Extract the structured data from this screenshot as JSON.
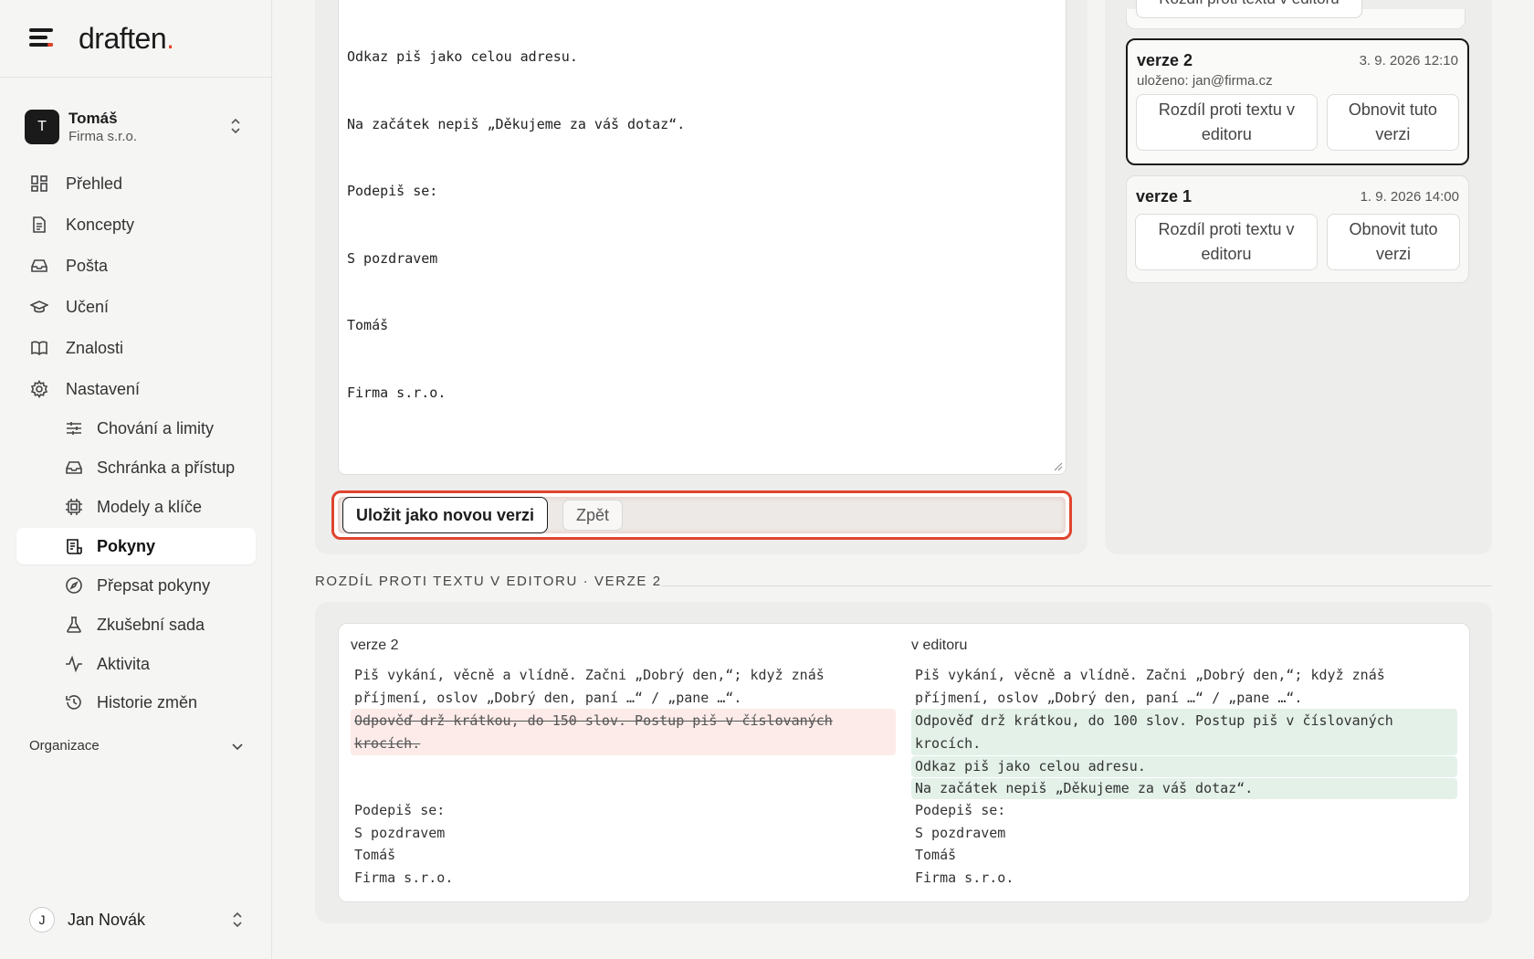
{
  "brand": {
    "name": "draften",
    "dot": "."
  },
  "org": {
    "initial": "T",
    "name": "Tomáš",
    "company": "Firma s.r.o."
  },
  "nav": {
    "items": [
      {
        "label": "Přehled"
      },
      {
        "label": "Koncepty"
      },
      {
        "label": "Pošta"
      },
      {
        "label": "Učení"
      },
      {
        "label": "Znalosti"
      },
      {
        "label": "Nastavení"
      }
    ],
    "sub_items": [
      {
        "label": "Chování a limity"
      },
      {
        "label": "Schránka a přístup"
      },
      {
        "label": "Modely a klíče"
      },
      {
        "label": "Pokyny"
      },
      {
        "label": "Přepsat pokyny"
      },
      {
        "label": "Zkušební sada"
      },
      {
        "label": "Aktivita"
      },
      {
        "label": "Historie změn"
      }
    ],
    "active": "Pokyny",
    "org_section": "Organizace"
  },
  "user": {
    "initial": "J",
    "name": "Jan Novák"
  },
  "editor": {
    "lines": [
      "Odkaz piš jako celou adresu.",
      "Na začátek nepiš „Děkujeme za váš dotaz“.",
      "Podepiš se:",
      "S pozdravem",
      "Tomáš",
      "Firma s.r.o."
    ],
    "save_label": "Uložit jako novou verzi",
    "back_label": "Zpět"
  },
  "versions": {
    "top_button_label": "Rozdíl proti textu v editoru",
    "items": [
      {
        "name": "verze 2",
        "date": "3. 9. 2026 12:10",
        "saved_by": "uloženo: jan@firma.cz",
        "diff_label_1": "Rozdíl proti textu v",
        "diff_label_2": "editoru",
        "restore_label_1": "Obnovit tuto",
        "restore_label_2": "verzi"
      },
      {
        "name": "verze 1",
        "date": "1. 9. 2026 14:00",
        "diff_label_1": "Rozdíl proti textu v",
        "diff_label_2": "editoru",
        "restore_label_1": "Obnovit tuto",
        "restore_label_2": "verzi"
      }
    ]
  },
  "diff": {
    "title": "ROZDÍL PROTI TEXTU V EDITORU · VERZE 2",
    "left_label": "verze 2",
    "right_label": "v editoru",
    "left": {
      "common_top": [
        "Piš vykání, věcně a vlídně. Začni „Dobrý den,“; když znáš",
        "příjmení, oslov „Dobrý den, paní …“ / „pane …“."
      ],
      "removed": [
        "Odpověď drž krátkou, do 150 slov. Postup piš v číslovaných",
        "krocích."
      ],
      "common_bottom": [
        "Podepiš se:",
        "S pozdravem",
        "Tomáš",
        "Firma s.r.o."
      ]
    },
    "right": {
      "common_top": [
        "Piš vykání, věcně a vlídně. Začni „Dobrý den,“; když znáš",
        "příjmení, oslov „Dobrý den, paní …“ / „pane …“."
      ],
      "added": [
        "Odpověď drž krátkou, do 100 slov. Postup piš v číslovaných",
        "krocích.",
        "Odkaz piš jako celou adresu.",
        "Na začátek nepiš „Děkujeme za váš dotaz“."
      ],
      "common_bottom": [
        "Podepiš se:",
        "S pozdravem",
        "Tomáš",
        "Firma s.r.o."
      ]
    }
  },
  "colors": {
    "accent_focus": "#e0442f",
    "brand_dot": "#e2432b",
    "diff_removed_bg": "#fcebe8",
    "diff_added_bg": "#e3f1e9"
  }
}
